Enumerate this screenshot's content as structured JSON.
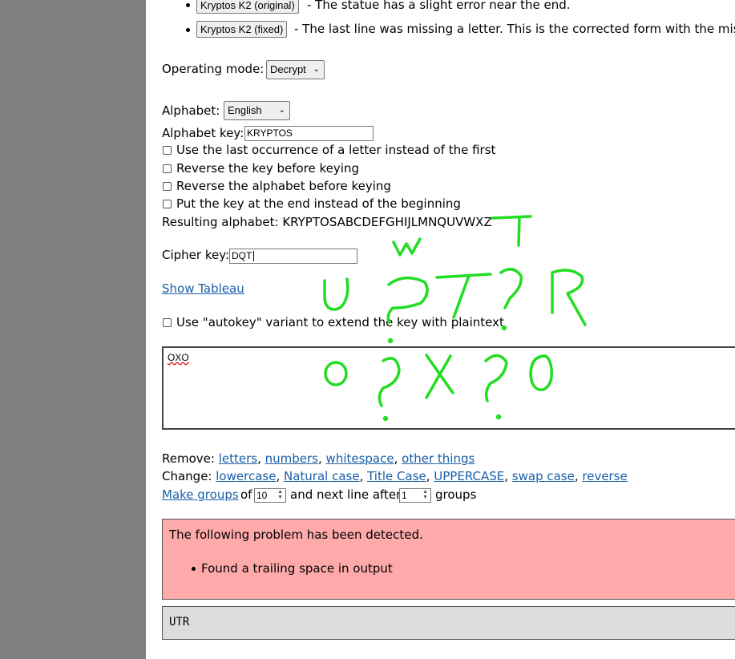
{
  "examples": [
    {
      "button": "Kryptos K2 (original)",
      "description": "- The statue has a slight error near the end."
    },
    {
      "button": "Kryptos K2 (fixed)",
      "description": "- The last line was missing a letter. This is the corrected form with the missing"
    }
  ],
  "operating_mode": {
    "label": "Operating mode:",
    "value": "Decrypt"
  },
  "alphabet": {
    "label": "Alphabet:",
    "value": "English"
  },
  "alphabet_key": {
    "label": "Alphabet key:",
    "value": "KRYPTOS"
  },
  "options": [
    "Use the last occurrence of a letter instead of the first",
    "Reverse the key before keying",
    "Reverse the alphabet before keying",
    "Put the key at the end instead of the beginning"
  ],
  "resulting_alphabet": "Resulting alphabet: KRYPTOSABCDEFGHIJLMNQUVWXZ",
  "cipher_key": {
    "label": "Cipher key:",
    "value": "DQT"
  },
  "show_tableau": "Show Tableau",
  "autokey_label": "Use \"autokey\" variant to extend the key with plaintext",
  "input_text": "OXO",
  "remove": {
    "label": "Remove:",
    "links": [
      "letters",
      "numbers",
      "whitespace",
      "other things"
    ]
  },
  "change": {
    "label": "Change:",
    "links": [
      "lowercase",
      "Natural case",
      "Title Case",
      "UPPERCASE",
      "swap case",
      "reverse"
    ]
  },
  "groups": {
    "link": "Make groups",
    "of": "of",
    "group_size": "10",
    "next_line": "and next line after",
    "line_after": "1",
    "suffix": "groups"
  },
  "problem": {
    "heading": "The following problem has been detected.",
    "items": [
      "Found a trailing space in output"
    ]
  },
  "output": "UTR",
  "colors": {
    "accent_link": "#1a5ea8",
    "problem_bg": "#ffaaaa",
    "output_bg": "#dddddd",
    "scribble": "#22dd22",
    "backdrop": "#808080"
  },
  "annotation_icon": "handwritten-scribble"
}
